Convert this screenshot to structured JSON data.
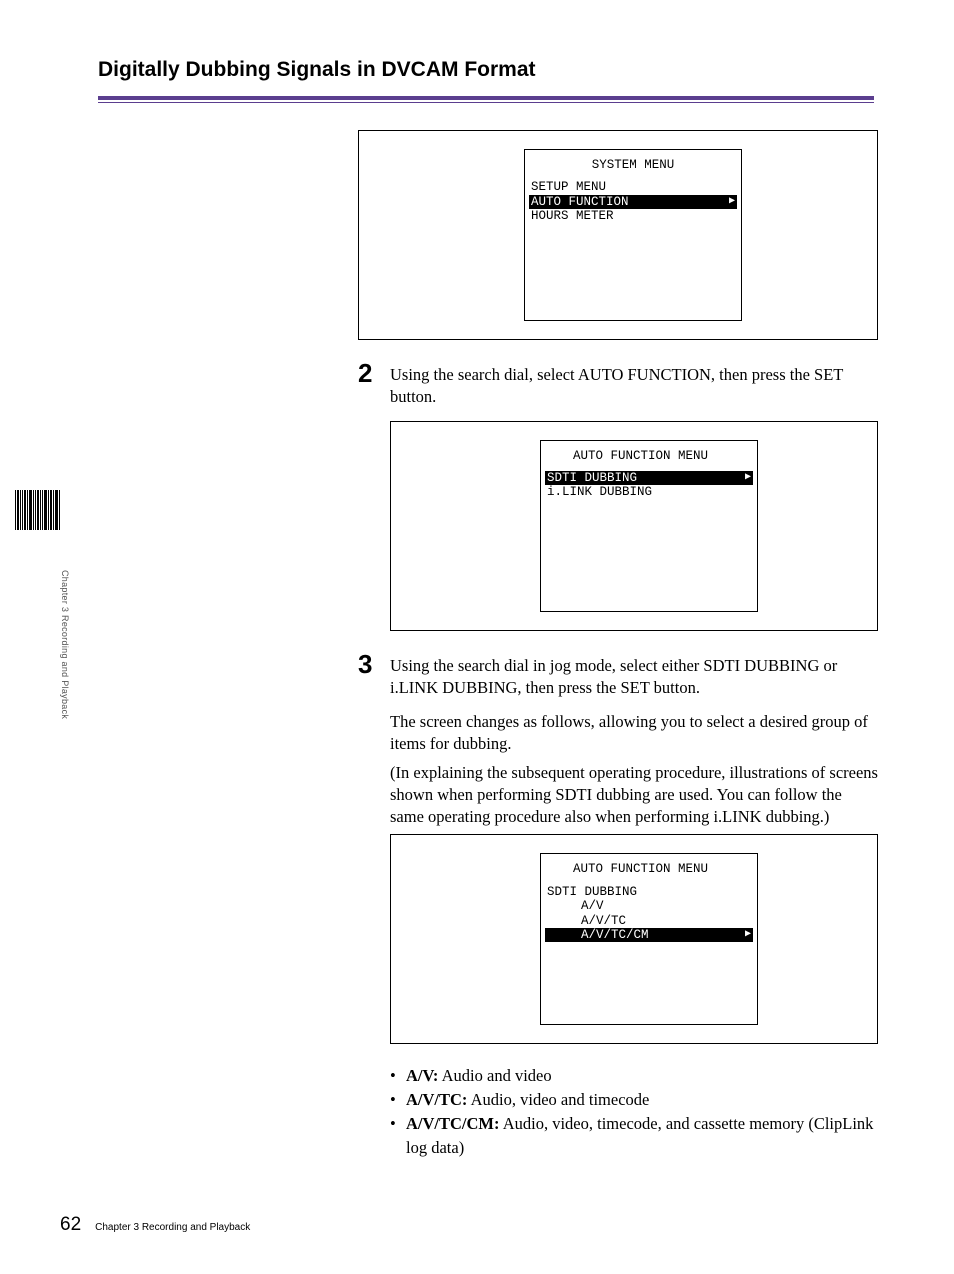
{
  "header": {
    "title": "Digitally Dubbing Signals in DVCAM Format"
  },
  "side": {
    "chapter": "Chapter 3   Recording and Playback"
  },
  "menu1": {
    "title": "SYSTEM MENU",
    "items": [
      "SETUP MENU",
      "AUTO FUNCTION",
      "HOURS METER"
    ],
    "selectedIndex": 1
  },
  "step2": {
    "num": "2",
    "text": "Using the search dial, select AUTO FUNCTION, then press the SET button."
  },
  "menu2": {
    "title": "AUTO FUNCTION MENU",
    "items": [
      "SDTI DUBBING",
      "i.LINK DUBBING"
    ],
    "selectedIndex": 0
  },
  "step3": {
    "num": "3",
    "text": "Using the search dial in jog mode, select either SDTI DUBBING or i.LINK DUBBING, then press the SET button."
  },
  "para1": "The screen changes as follows, allowing you to select a desired group of items for dubbing.",
  "para2": "(In explaining the subsequent operating procedure, illustrations of screens shown when performing SDTI dubbing are used. You can follow the same operating procedure also when performing i.LINK dubbing.)",
  "menu3": {
    "title": "AUTO FUNCTION MENU",
    "sub": "SDTI DUBBING",
    "items": [
      "A/V",
      "A/V/TC",
      "A/V/TC/CM"
    ],
    "selectedIndex": 2
  },
  "bullets": [
    {
      "label": "A/V:",
      "desc": " Audio and video"
    },
    {
      "label": "A/V/TC:",
      "desc": " Audio, video and timecode"
    },
    {
      "label": "A/V/TC/CM:",
      "desc": " Audio, video, timecode, and cassette memory (ClipLink log data)"
    }
  ],
  "footer": {
    "page": "62",
    "text": "Chapter 3   Recording and Playback"
  }
}
